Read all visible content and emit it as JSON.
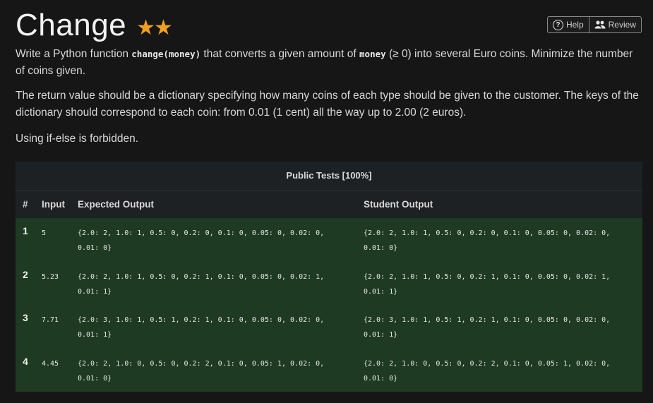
{
  "title": "Change",
  "stars": "★★",
  "buttons": {
    "help_icon": "?",
    "help": "Help",
    "review": "Review",
    "help_icon_name": "question-circle-icon",
    "review_icon_name": "users-icon"
  },
  "description": {
    "p1_a": "Write a Python function ",
    "p1_code1": "change(money)",
    "p1_b": " that converts a given amount of ",
    "p1_code2": "money",
    "p1_c": " (≥ 0) into several Euro coins. Minimize the number of coins given.",
    "p2": "The return value should be a dictionary specifying how many coins of each type should be given to the customer. The keys of the dictionary should correspond to each coin: from 0.01 (1 cent) all the way up to 2.00 (2 euros).",
    "p3": "Using if-else is forbidden."
  },
  "tests": {
    "heading": "Public Tests [100%]",
    "columns": {
      "num": "#",
      "input": "Input",
      "expected": "Expected Output",
      "student": "Student Output"
    },
    "row_color": "#1e3a22",
    "rows": [
      {
        "num": "1",
        "input": "5",
        "expected": "{2.0: 2, 1.0: 1, 0.5: 0, 0.2: 0, 0.1: 0, 0.05: 0, 0.02: 0, 0.01: 0}",
        "student": "{2.0: 2, 1.0: 1, 0.5: 0, 0.2: 0, 0.1: 0, 0.05: 0, 0.02: 0, 0.01: 0}"
      },
      {
        "num": "2",
        "input": "5.23",
        "expected": "{2.0: 2, 1.0: 1, 0.5: 0, 0.2: 1, 0.1: 0, 0.05: 0, 0.02: 1, 0.01: 1}",
        "student": "{2.0: 2, 1.0: 1, 0.5: 0, 0.2: 1, 0.1: 0, 0.05: 0, 0.02: 1, 0.01: 1}"
      },
      {
        "num": "3",
        "input": "7.71",
        "expected": "{2.0: 3, 1.0: 1, 0.5: 1, 0.2: 1, 0.1: 0, 0.05: 0, 0.02: 0, 0.01: 1}",
        "student": "{2.0: 3, 1.0: 1, 0.5: 1, 0.2: 1, 0.1: 0, 0.05: 0, 0.02: 0, 0.01: 1}"
      },
      {
        "num": "4",
        "input": "4.45",
        "expected": "{2.0: 2, 1.0: 0, 0.5: 0, 0.2: 2, 0.1: 0, 0.05: 1, 0.02: 0, 0.01: 0}",
        "student": "{2.0: 2, 1.0: 0, 0.5: 0, 0.2: 2, 0.1: 0, 0.05: 1, 0.02: 0, 0.01: 0}"
      }
    ]
  }
}
